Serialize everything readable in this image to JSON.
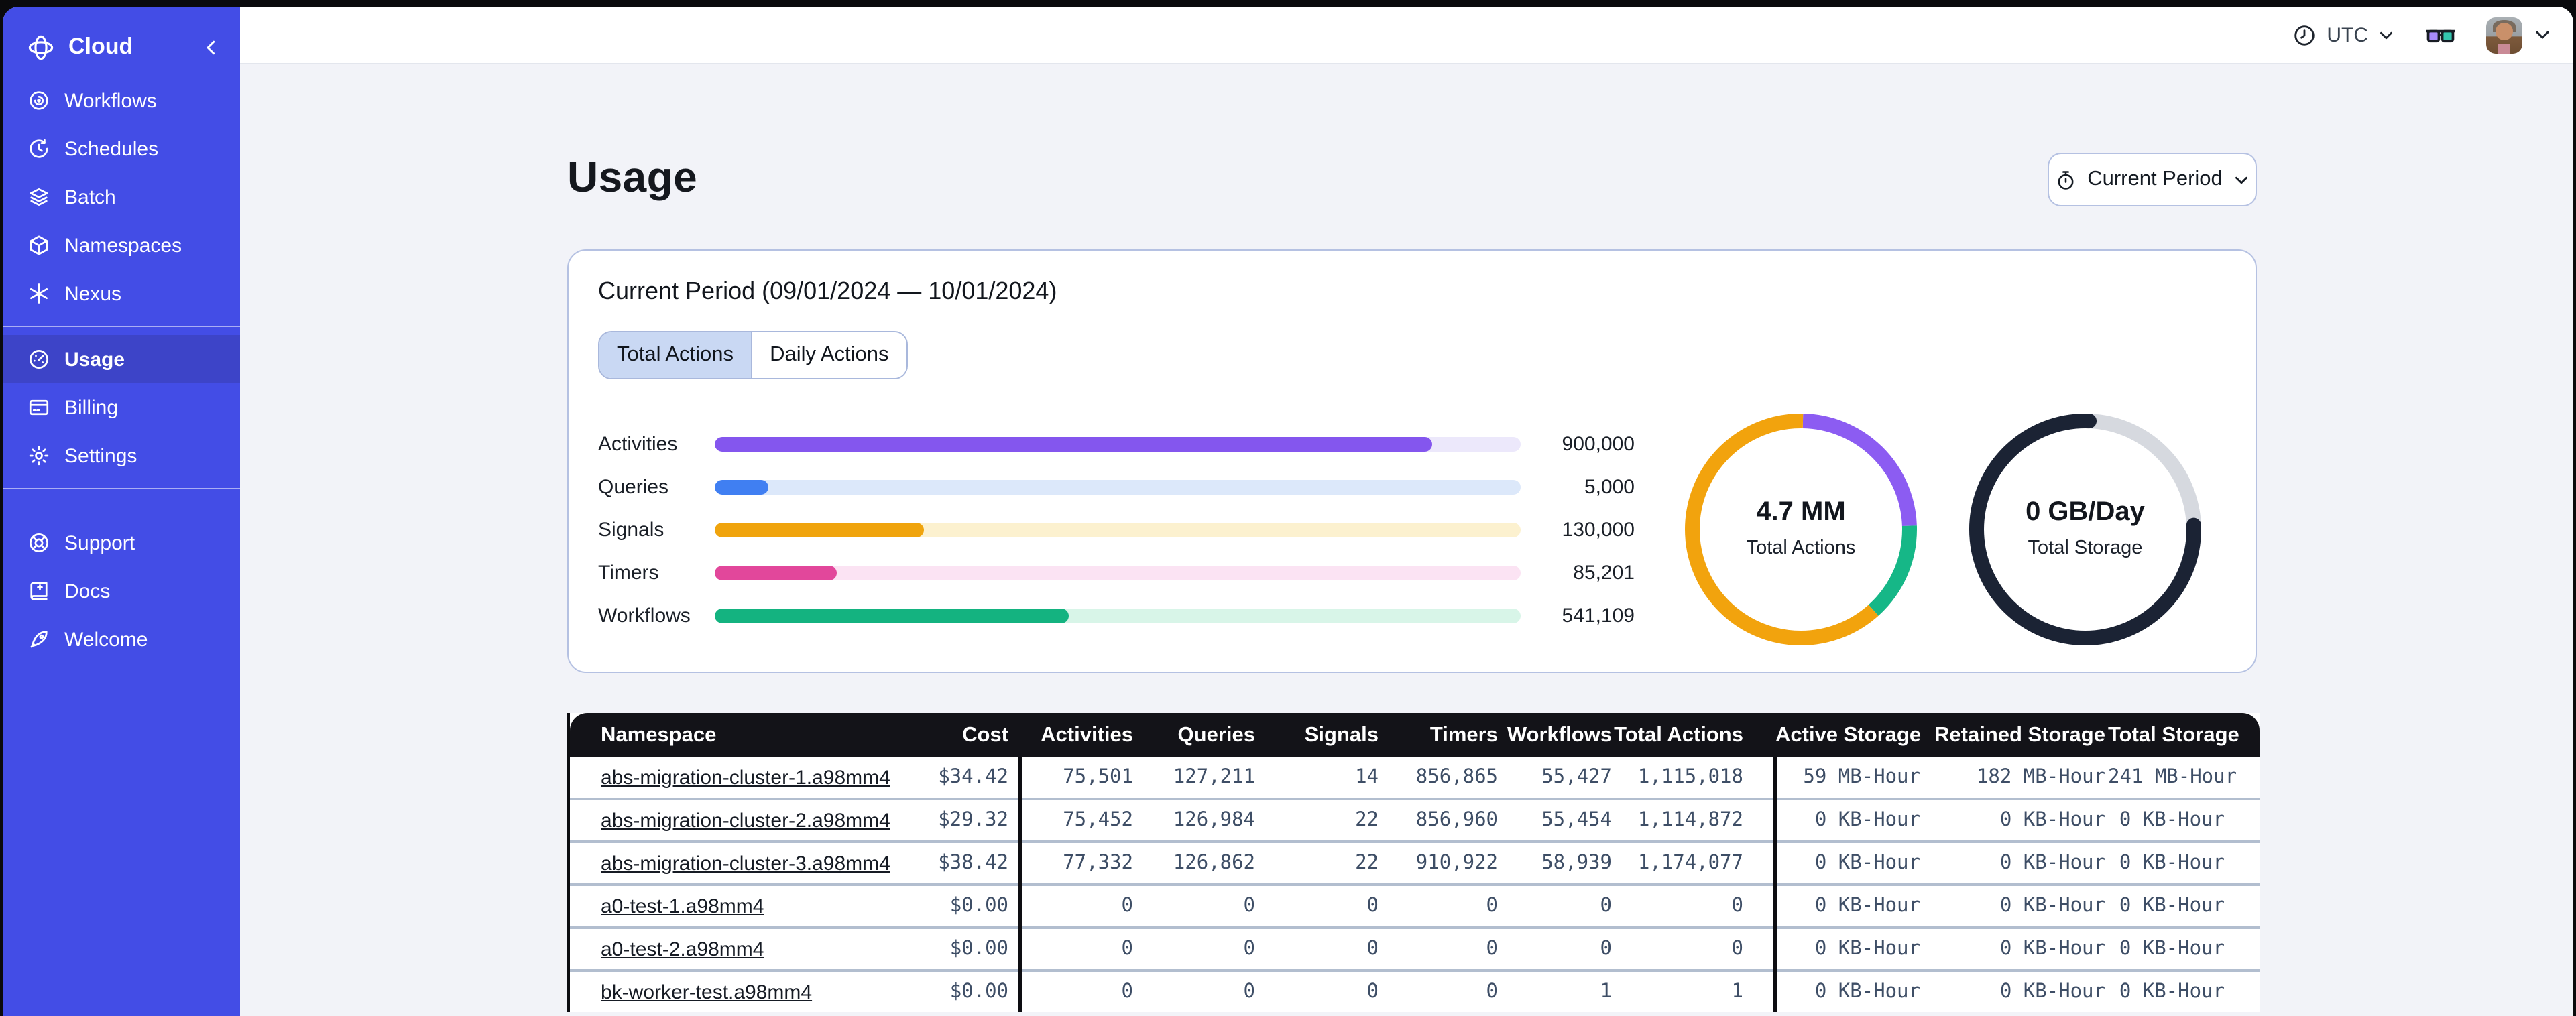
{
  "accent_colors": {
    "sidebar": "#434de6",
    "sidebar_active": "#3d44c8",
    "panel_border": "#b5c1e2",
    "table_header_bg": "#131318"
  },
  "sidebar": {
    "brand": {
      "label": "Cloud"
    },
    "groups": [
      {
        "items": [
          {
            "icon": "workflows",
            "label": "Workflows",
            "active": false
          },
          {
            "icon": "schedules",
            "label": "Schedules",
            "active": false
          },
          {
            "icon": "batch",
            "label": "Batch",
            "active": false
          },
          {
            "icon": "namespaces",
            "label": "Namespaces",
            "active": false
          },
          {
            "icon": "nexus",
            "label": "Nexus",
            "active": false
          }
        ]
      },
      {
        "items": [
          {
            "icon": "usage",
            "label": "Usage",
            "active": true
          },
          {
            "icon": "billing",
            "label": "Billing",
            "active": false
          },
          {
            "icon": "settings",
            "label": "Settings",
            "active": false
          }
        ]
      },
      {
        "items": [
          {
            "icon": "support",
            "label": "Support",
            "active": false
          },
          {
            "icon": "docs",
            "label": "Docs",
            "active": false
          },
          {
            "icon": "welcome",
            "label": "Welcome",
            "active": false
          }
        ]
      }
    ]
  },
  "topbar": {
    "timezone": "UTC"
  },
  "page": {
    "title": "Usage",
    "period_button": "Current Period",
    "panel_heading": "Current Period (09/01/2024 — 10/01/2024)",
    "tabs": [
      {
        "label": "Total Actions",
        "active": true
      },
      {
        "label": "Daily Actions",
        "active": false
      }
    ]
  },
  "chart_data": [
    {
      "type": "bar",
      "orientation": "horizontal",
      "categories": [
        "Activities",
        "Queries",
        "Signals",
        "Timers",
        "Workflows"
      ],
      "values": [
        900000,
        5000,
        130000,
        85201,
        541109
      ],
      "value_labels": [
        "900,000",
        "5,000",
        "130,000",
        "85,201",
        "541,109"
      ],
      "fill_pct": [
        89,
        6.6,
        26,
        15.2,
        44
      ],
      "colors": [
        "#8456ee",
        "#407ff2",
        "#f0a40d",
        "#e2479b",
        "#14b380"
      ],
      "track_colors": [
        "#ece8fb",
        "#dce8fa",
        "#fcf1cf",
        "#fbe3f3",
        "#d8f5e8"
      ],
      "legend": false,
      "grid": false
    },
    {
      "type": "donut",
      "center_value": "4.7 MM",
      "center_label": "Total Actions",
      "segments": [
        {
          "name": "activities",
          "color": "#8c5cf2",
          "start_pct": 0.3,
          "pct": 24.2
        },
        {
          "name": "workflows",
          "color": "#16b787",
          "start_pct": 24.5,
          "pct": 13.9
        },
        {
          "name": "signals",
          "color": "#f2a30d",
          "start_pct": 38.4,
          "pct": 61.9
        }
      ]
    },
    {
      "type": "donut",
      "center_value": "0 GB/Day",
      "center_label": "Total Storage",
      "track_color": "#d6d9df",
      "segments": [
        {
          "name": "storage-used",
          "color": "#1b2334",
          "start_pct": 24.4,
          "pct": 76.2,
          "rounded": true
        }
      ]
    }
  ],
  "usage_table": {
    "headers": [
      "Namespace",
      "Cost",
      "Activities",
      "Queries",
      "Signals",
      "Timers",
      "Workflows",
      "Total Actions",
      "Active Storage",
      "Retained Storage",
      "Total Storage"
    ],
    "rows": [
      [
        "abs-migration-cluster-1.a98mm4",
        "$34.42",
        "75,501",
        "127,211",
        "14",
        "856,865",
        "55,427",
        "1,115,018",
        "59 MB-Hour",
        "182 MB-Hour",
        "241 MB-Hour"
      ],
      [
        "abs-migration-cluster-2.a98mm4",
        "$29.32",
        "75,452",
        "126,984",
        "22",
        "856,960",
        "55,454",
        "1,114,872",
        "0 KB-Hour",
        "0 KB-Hour",
        "0 KB-Hour"
      ],
      [
        "abs-migration-cluster-3.a98mm4",
        "$38.42",
        "77,332",
        "126,862",
        "22",
        "910,922",
        "58,939",
        "1,174,077",
        "0 KB-Hour",
        "0 KB-Hour",
        "0 KB-Hour"
      ],
      [
        "a0-test-1.a98mm4",
        "$0.00",
        "0",
        "0",
        "0",
        "0",
        "0",
        "0",
        "0 KB-Hour",
        "0 KB-Hour",
        "0 KB-Hour"
      ],
      [
        "a0-test-2.a98mm4",
        "$0.00",
        "0",
        "0",
        "0",
        "0",
        "0",
        "0",
        "0 KB-Hour",
        "0 KB-Hour",
        "0 KB-Hour"
      ],
      [
        "bk-worker-test.a98mm4",
        "$0.00",
        "0",
        "0",
        "0",
        "0",
        "1",
        "1",
        "0 KB-Hour",
        "0 KB-Hour",
        "0 KB-Hour"
      ]
    ]
  }
}
